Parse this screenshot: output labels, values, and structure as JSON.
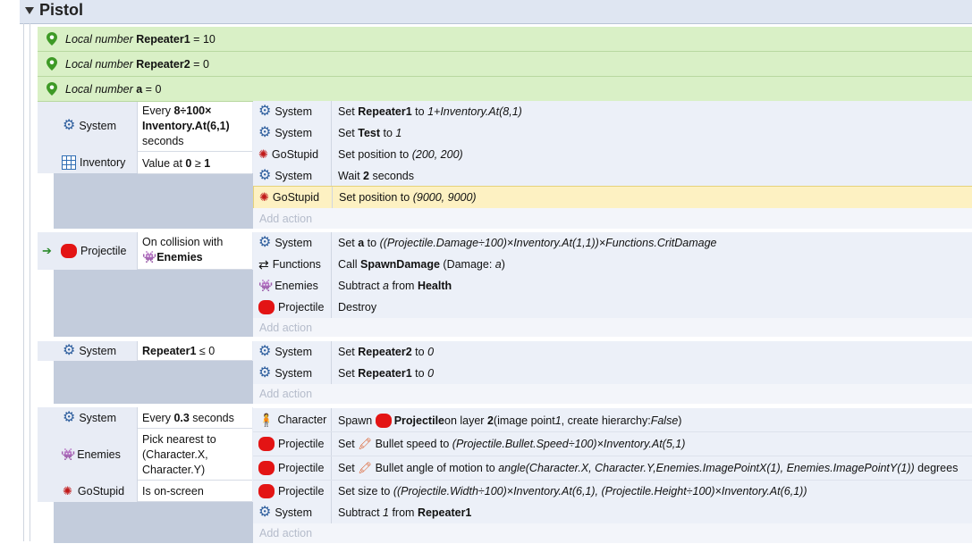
{
  "group": {
    "title": "Pistol"
  },
  "variables": [
    {
      "kind": "Local number",
      "name": "Repeater1",
      "op": "=",
      "value": "10"
    },
    {
      "kind": "Local number",
      "name": "Repeater2",
      "op": "=",
      "value": "0"
    },
    {
      "kind": "Local number",
      "name": "a",
      "op": "=",
      "value": "0"
    }
  ],
  "event1": {
    "conditions": [
      {
        "object": "System",
        "text1": "Every ",
        "bold1": "8÷100×",
        "bold2": "Inventory.At(6,1)",
        "text2": "seconds"
      },
      {
        "object": "Inventory",
        "text": "Value at ",
        "bold": "0",
        "op": " ≥ ",
        "bold2": "1"
      }
    ],
    "actions": [
      {
        "object": "System",
        "a": "Set ",
        "b": "Repeater1",
        "c": " to ",
        "d": "1+Inventory.At(8,1)"
      },
      {
        "object": "System",
        "a": "Set ",
        "b": "Test",
        "c": " to ",
        "d": "1"
      },
      {
        "object": "GoStupid",
        "a": "Set position to ",
        "d": "(200, 200)"
      },
      {
        "object": "System",
        "a": "Wait ",
        "b": "2",
        "c": " seconds"
      },
      {
        "object": "GoStupid",
        "a": "Set position to ",
        "d": "(9000, 9000)"
      }
    ],
    "add_action": "Add action"
  },
  "event2": {
    "conditions": [
      {
        "object": "Projectile",
        "text": "On collision with",
        "target": "Enemies"
      }
    ],
    "actions": [
      {
        "object": "System",
        "a": "Set ",
        "b": "a",
        "c": " to ",
        "d": "((Projectile.Damage÷100)×Inventory.At(1,1))×Functions.CritDamage"
      },
      {
        "object": "Functions",
        "a": "Call ",
        "b": "SpawnDamage",
        "c": " (Damage: ",
        "d": "a",
        "e": ")"
      },
      {
        "object": "Enemies",
        "a": "Subtract ",
        "d": "a",
        "c": " from ",
        "b": "Health"
      },
      {
        "object": "Projectile",
        "a": "Destroy"
      }
    ],
    "add_action": "Add action"
  },
  "event3": {
    "conditions": [
      {
        "object": "System",
        "bold": "Repeater1",
        "op": " ≤ ",
        "value": "0"
      }
    ],
    "actions": [
      {
        "object": "System",
        "a": "Set ",
        "b": "Repeater2",
        "c": " to ",
        "d": "0"
      },
      {
        "object": "System",
        "a": "Set ",
        "b": "Repeater1",
        "c": " to ",
        "d": "0"
      }
    ],
    "add_action": "Add action"
  },
  "event4": {
    "conditions": [
      {
        "object": "System",
        "text": "Every ",
        "bold": "0.3",
        "text2": " seconds"
      },
      {
        "object": "Enemies",
        "line1": "Pick nearest to",
        "line2": "(Character.X,",
        "line3": "Character.Y)"
      },
      {
        "object": "GoStupid",
        "text": "Is on-screen"
      }
    ],
    "actions": [
      {
        "object": "Character",
        "a": "Spawn ",
        "b": "Projectile",
        "c": " on layer ",
        "d": "2",
        "e": " (image point ",
        "f": "1",
        "g": ", create hierarchy: ",
        "h": "False",
        "i": ")"
      },
      {
        "object": "Projectile",
        "a": "Set ",
        "b": " Bullet speed to ",
        "d": "(Projectile.Bullet.Speed÷100)×Inventory.At(5,1)"
      },
      {
        "object": "Projectile",
        "a": "Set ",
        "b": " Bullet angle of motion to ",
        "d": "angle(Character.X, Character.Y,Enemies.ImagePointX(1), Enemies.ImagePointY(1))",
        "e": " degrees"
      },
      {
        "object": "Projectile",
        "a": "Set size to ",
        "d": "((Projectile.Width÷100)×Inventory.At(6,1), (Projectile.Height÷100)×Inventory.At(6,1))"
      },
      {
        "object": "System",
        "a": "Subtract ",
        "d": "1",
        "c": " from ",
        "b": "Repeater1"
      }
    ],
    "add_action": "Add action"
  },
  "colors": {
    "variable_bg": "#d9f0c6",
    "event_bg": "#e8ecf5",
    "highlight": "#fdf1c2",
    "group_header": "#dfe6f2"
  }
}
